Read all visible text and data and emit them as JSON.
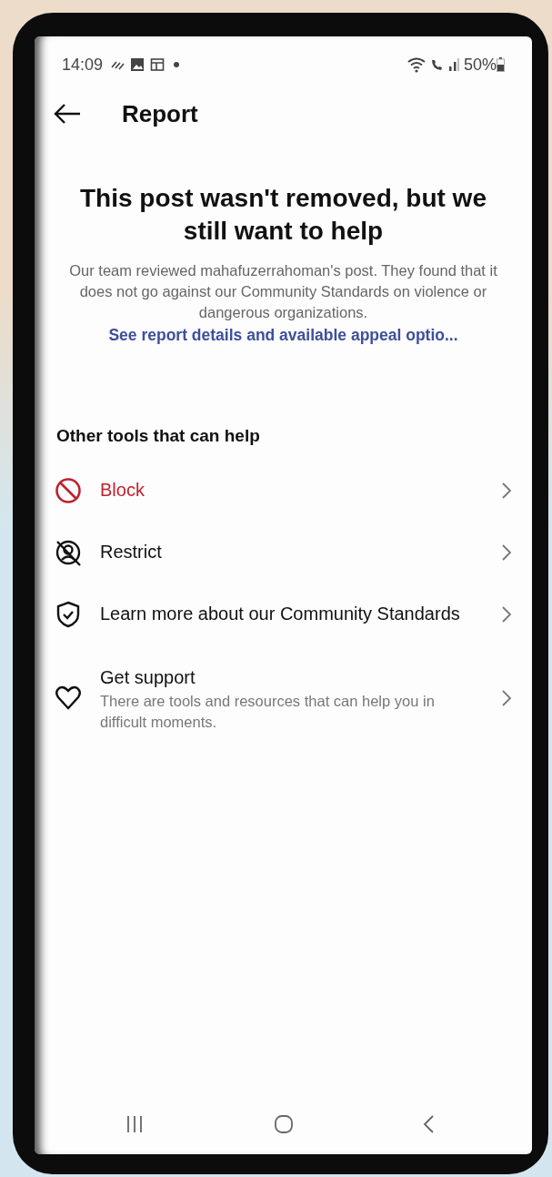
{
  "status_bar": {
    "time": "14:09",
    "battery": "50%"
  },
  "header": {
    "title": "Report"
  },
  "notice": {
    "heading": "This post wasn't removed, but we still want to help",
    "body": "Our team reviewed mahafuzerrahoman's post. They found that it does not go against our Community Standards on violence or dangerous organizations.",
    "link": "See report details and available appeal optio..."
  },
  "tools": {
    "heading": "Other tools that can help",
    "items": [
      {
        "label": "Block",
        "color": "#c0202e"
      },
      {
        "label": "Restrict",
        "color": "#111111"
      },
      {
        "label": "Learn more about our Community Standards",
        "color": "#111111"
      },
      {
        "label": "Get support",
        "subtitle": "There are tools and resources that can help you in difficult moments.",
        "color": "#111111"
      }
    ]
  }
}
